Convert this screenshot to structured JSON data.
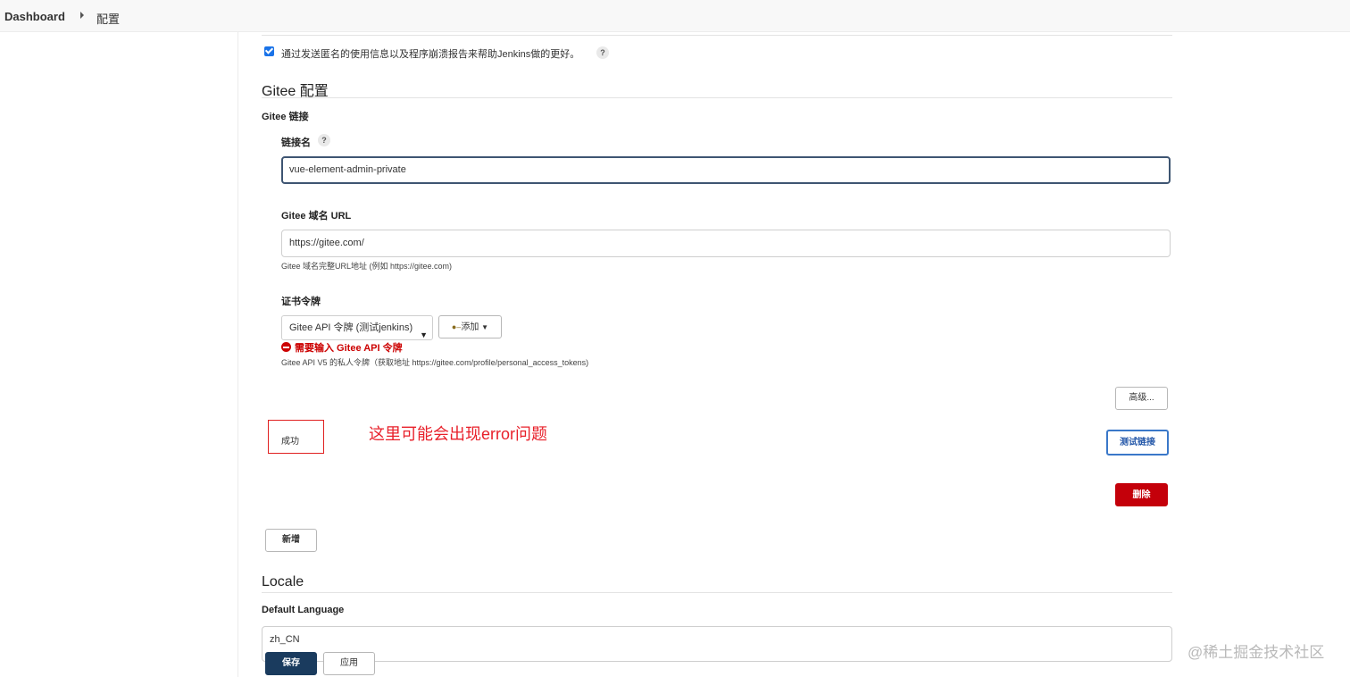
{
  "breadcrumb": {
    "dashboard": "Dashboard",
    "page": "配置"
  },
  "usage": {
    "label": "通过发送匿名的使用信息以及程序崩溃报告来帮助Jenkins做的更好。",
    "checked": true
  },
  "help_mark": "?",
  "gitee": {
    "title": "Gitee 配置",
    "connections_label": "Gitee 链接",
    "name_label": "链接名",
    "name_value": "vue-element-admin-private",
    "url_label": "Gitee 域名 URL",
    "url_value": "https://gitee.com/",
    "url_hint": "Gitee 域名完整URL地址 (例如 https://gitee.com)",
    "token_label": "证书令牌",
    "token_selected": "Gitee API 令牌 (测试jenkins)",
    "add_label": "添加",
    "token_error": "需要输入 Gitee API 令牌",
    "token_hint": "Gitee API V5 的私人令牌（获取地址 https://gitee.com/profile/personal_access_tokens)",
    "advanced_label": "高级...",
    "test_label": "测试链接",
    "delete_label": "删除",
    "new_label": "新增"
  },
  "test_result": "成功",
  "annotation": "这里可能会出现error问题",
  "locale": {
    "title": "Locale",
    "default_language_label": "Default Language",
    "default_language_value": "zh_CN"
  },
  "actions": {
    "save_label": "保存",
    "apply_label": "应用"
  },
  "watermark": "@稀土掘金技术社区",
  "colors": {
    "error": "#cc0000",
    "delete": "#c4000a",
    "save": "#1a3b5e",
    "annotation": "#e8202a",
    "checkbox": "#1a73e8"
  },
  "icons": {
    "breadcrumb_separator": "caret-right-icon",
    "error": "error-circle-icon",
    "add": "key-icon"
  }
}
